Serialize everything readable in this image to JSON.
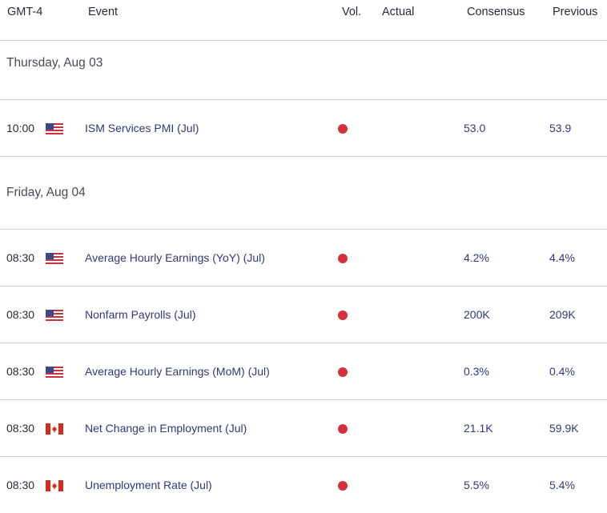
{
  "header": {
    "timezone": "GMT-4",
    "event": "Event",
    "vol": "Vol.",
    "actual": "Actual",
    "consensus": "Consensus",
    "previous": "Previous"
  },
  "days": [
    {
      "label": "Thursday, Aug 03",
      "events": [
        {
          "time": "10:00",
          "flag": "us-flag-icon",
          "event": "ISM Services PMI (Jul)",
          "volatility": "high",
          "actual": "",
          "consensus": "53.0",
          "previous": "53.9"
        }
      ]
    },
    {
      "label": "Friday, Aug 04",
      "events": [
        {
          "time": "08:30",
          "flag": "us-flag-icon",
          "event": "Average Hourly Earnings (YoY) (Jul)",
          "volatility": "high",
          "actual": "",
          "consensus": "4.2%",
          "previous": "4.4%"
        },
        {
          "time": "08:30",
          "flag": "us-flag-icon",
          "event": "Nonfarm Payrolls (Jul)",
          "volatility": "high",
          "actual": "",
          "consensus": "200K",
          "previous": "209K"
        },
        {
          "time": "08:30",
          "flag": "us-flag-icon",
          "event": "Average Hourly Earnings (MoM) (Jul)",
          "volatility": "high",
          "actual": "",
          "consensus": "0.3%",
          "previous": "0.4%"
        },
        {
          "time": "08:30",
          "flag": "canada-flag-icon",
          "event": "Net Change in Employment (Jul)",
          "volatility": "high",
          "actual": "",
          "consensus": "21.1K",
          "previous": "59.9K"
        },
        {
          "time": "08:30",
          "flag": "canada-flag-icon",
          "event": "Unemployment Rate (Jul)",
          "volatility": "high",
          "actual": "",
          "consensus": "5.5%",
          "previous": "5.4%"
        }
      ]
    }
  ],
  "colors": {
    "volatility_high": "#d6303c",
    "link": "#2e3a7a"
  }
}
